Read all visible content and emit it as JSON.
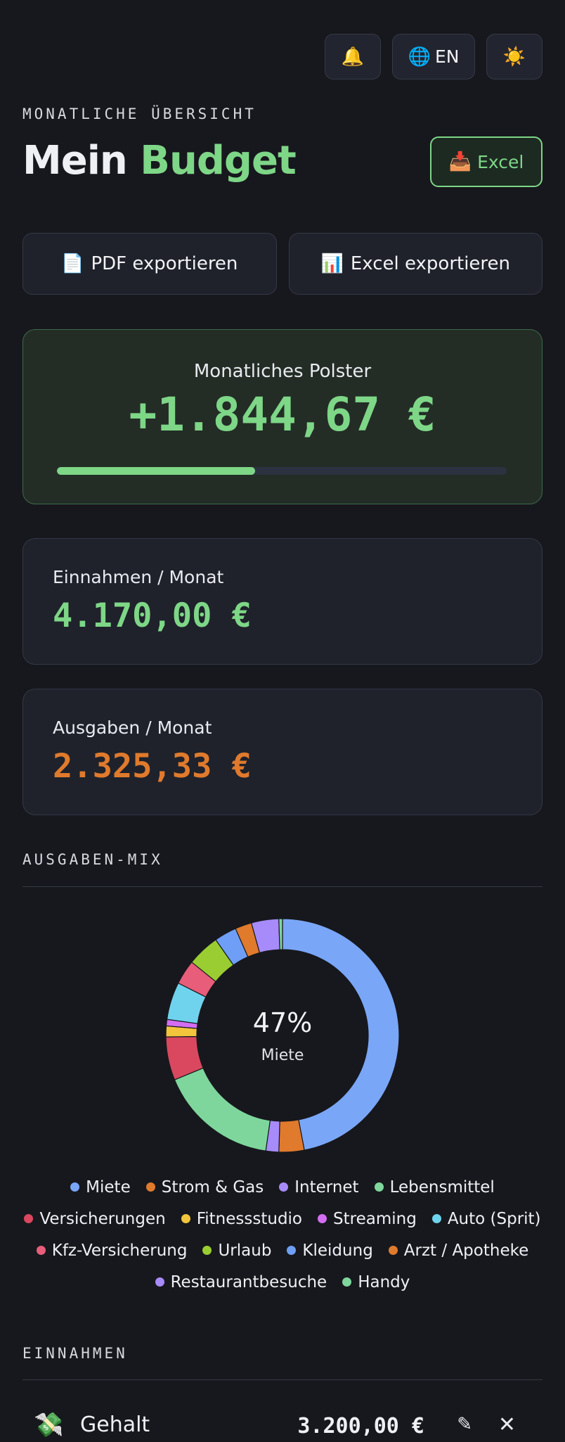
{
  "topbar": {
    "bell_icon": "🔔",
    "globe_icon": "🌐",
    "lang_label": "EN",
    "theme_icon": "☀️"
  },
  "header": {
    "eyebrow": "MONATLICHE ÜBERSICHT",
    "title_main": "Mein",
    "title_accent": "Budget",
    "import_icon": "📥",
    "import_label": "Excel"
  },
  "exports": {
    "pdf_icon": "📄",
    "pdf_label": "PDF exportieren",
    "excel_icon": "📊",
    "excel_label": "Excel exportieren"
  },
  "polster": {
    "label": "Monatliches Polster",
    "value": "+1.844,67 €",
    "progress_percent": 44
  },
  "income_card": {
    "label": "Einnahmen / Monat",
    "value": "4.170,00 €"
  },
  "expense_card": {
    "label": "Ausgaben / Monat",
    "value": "2.325,33 €"
  },
  "mix": {
    "heading": "AUSGABEN-MIX",
    "center_pct": "47%",
    "center_label": "Miete"
  },
  "chart_data": {
    "type": "pie",
    "title": "AUSGABEN-MIX",
    "donut": true,
    "slices": [
      {
        "name": "Miete",
        "percent": 47,
        "color": "#7aa6f7"
      },
      {
        "name": "Strom & Gas",
        "percent": 3.5,
        "color": "#e07a2c"
      },
      {
        "name": "Internet",
        "percent": 1.8,
        "color": "#a78bfa"
      },
      {
        "name": "Lebensmittel",
        "percent": 16.5,
        "color": "#7ed69c"
      },
      {
        "name": "Versicherungen",
        "percent": 6.0,
        "color": "#d9485f"
      },
      {
        "name": "Fitnessstudio",
        "percent": 1.5,
        "color": "#f2c53d"
      },
      {
        "name": "Streaming",
        "percent": 0.9,
        "color": "#d36ef2"
      },
      {
        "name": "Auto (Sprit)",
        "percent": 5.2,
        "color": "#6fd3ee"
      },
      {
        "name": "Kfz-Versicherung",
        "percent": 3.4,
        "color": "#e85d7a"
      },
      {
        "name": "Urlaub",
        "percent": 4.5,
        "color": "#9acd32"
      },
      {
        "name": "Kleidung",
        "percent": 3.1,
        "color": "#6f9ef7"
      },
      {
        "name": "Arzt / Apotheke",
        "percent": 2.3,
        "color": "#e07a2c"
      },
      {
        "name": "Restaurantbesuche",
        "percent": 3.8,
        "color": "#a78bfa"
      },
      {
        "name": "Handy",
        "percent": 0.5,
        "color": "#7ed69c"
      }
    ]
  },
  "income_section": {
    "heading": "EINNAHMEN",
    "items": [
      {
        "icon": "💸",
        "name": "Gehalt",
        "amount": "3.200,00 €",
        "edit_icon": "✎",
        "delete_icon": "✕"
      }
    ]
  }
}
